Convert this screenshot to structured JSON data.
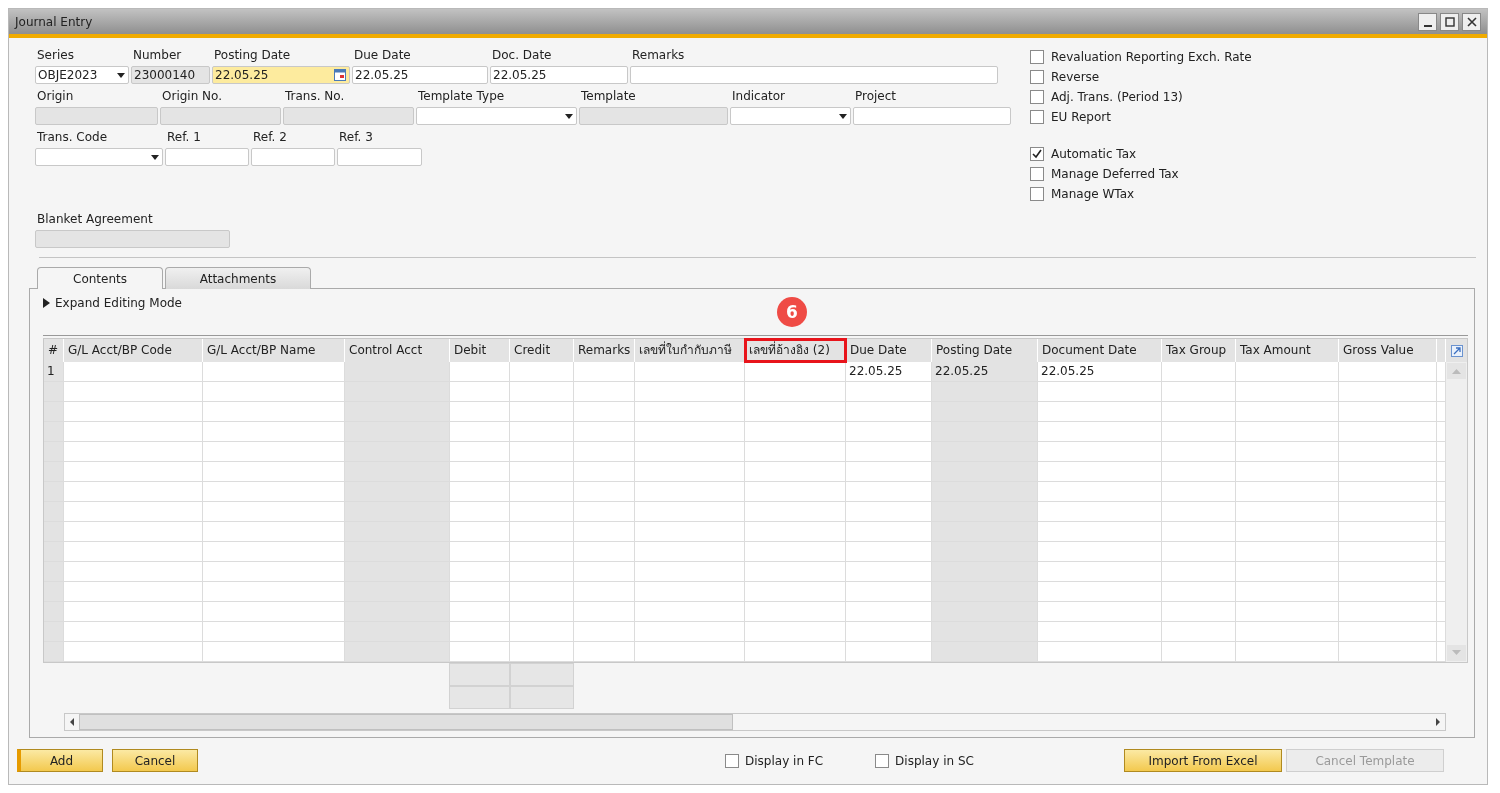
{
  "window": {
    "title": "Journal Entry"
  },
  "field_rows": [
    {
      "fields": [
        {
          "label": "Series",
          "value": "OBJE2023",
          "kind": "dropdown",
          "disabled": false,
          "focused": false
        },
        {
          "label": "Number",
          "value": "23000140",
          "kind": "text",
          "disabled": true,
          "focused": false
        },
        {
          "label": "Posting Date",
          "value": "22.05.25",
          "kind": "date",
          "disabled": false,
          "focused": true
        },
        {
          "label": "Due Date",
          "value": "22.05.25",
          "kind": "text",
          "disabled": false,
          "focused": false
        },
        {
          "label": "Doc. Date",
          "value": "22.05.25",
          "kind": "text",
          "disabled": false,
          "focused": false
        },
        {
          "label": "Remarks",
          "kind": "text",
          "disabled": false,
          "focused": false
        }
      ]
    },
    {
      "fields": [
        {
          "label": "Origin",
          "kind": "text",
          "disabled": true,
          "focused": false
        },
        {
          "label": "Origin No.",
          "kind": "text",
          "disabled": true,
          "focused": false
        },
        {
          "label": "Trans. No.",
          "kind": "text",
          "disabled": true,
          "focused": false
        },
        {
          "label": "Template Type",
          "kind": "dropdown",
          "disabled": false,
          "focused": false
        },
        {
          "label": "Template",
          "kind": "text",
          "disabled": true,
          "focused": false
        },
        {
          "label": "Indicator",
          "kind": "dropdown",
          "disabled": false,
          "focused": false
        },
        {
          "label": "Project",
          "kind": "text",
          "disabled": false,
          "focused": false
        }
      ]
    },
    {
      "fields": [
        {
          "label": "Trans. Code",
          "kind": "dropdown",
          "disabled": false,
          "focused": false
        },
        {
          "label": "Ref. 1",
          "kind": "text",
          "disabled": false,
          "focused": false
        },
        {
          "label": "Ref. 2",
          "kind": "text",
          "disabled": false,
          "focused": false
        },
        {
          "label": "Ref. 3",
          "kind": "text",
          "disabled": false,
          "focused": false
        }
      ]
    }
  ],
  "blanket_agreement": {
    "label": "Blanket Agreement",
    "disabled": true
  },
  "checkbox_groups": [
    {
      "items": [
        {
          "label": "Revaluation Reporting Exch. Rate",
          "checked": false
        },
        {
          "label": "Reverse",
          "checked": false
        },
        {
          "label": "Adj. Trans. (Period 13)",
          "checked": false
        },
        {
          "label": "EU Report",
          "checked": false
        }
      ]
    },
    {
      "items": [
        {
          "label": "Automatic Tax",
          "checked": true
        },
        {
          "label": "Manage Deferred Tax",
          "checked": false
        },
        {
          "label": "Manage WTax",
          "checked": false
        }
      ]
    }
  ],
  "tabs": [
    {
      "label": "Contents",
      "selected": true
    },
    {
      "label": "Attachments",
      "selected": false
    }
  ],
  "expand_toggle": {
    "label": "Expand Editing Mode",
    "expanded": false
  },
  "table": {
    "columns": [
      {
        "label": "#",
        "disabled": true
      },
      {
        "label": "G/L Acct/BP Code",
        "disabled": false
      },
      {
        "label": "G/L Acct/BP Name",
        "disabled": false
      },
      {
        "label": "Control Acct",
        "disabled": true
      },
      {
        "label": "Debit",
        "disabled": false
      },
      {
        "label": "Credit",
        "disabled": false
      },
      {
        "label": "Remarks",
        "disabled": false
      },
      {
        "label": "เลขที่ใบกำกับภาษี",
        "disabled": false
      },
      {
        "label": "เลขที่อ้างอิง (2)",
        "disabled": false,
        "annotation": {
          "badge": "6"
        }
      },
      {
        "label": "Due Date",
        "disabled": false
      },
      {
        "label": "Posting Date",
        "disabled": true
      },
      {
        "label": "Document Date",
        "disabled": false
      },
      {
        "label": "Tax Group",
        "disabled": false
      },
      {
        "label": "Tax Amount",
        "disabled": false
      },
      {
        "label": "Gross Value",
        "disabled": false
      }
    ],
    "rows": [
      {
        "cells": [
          "1",
          null,
          null,
          null,
          null,
          null,
          null,
          null,
          null,
          "22.05.25",
          "22.05.25",
          "22.05.25",
          null,
          null,
          null
        ]
      }
    ]
  },
  "footer": {
    "buttons": [
      {
        "label": "Add",
        "kind": "primary",
        "disabled": false
      },
      {
        "label": "Cancel",
        "kind": "normal",
        "disabled": false
      }
    ],
    "toggles": [
      {
        "label": "Display in FC",
        "checked": false
      },
      {
        "label": "Display in SC",
        "checked": false
      }
    ],
    "right_buttons": [
      {
        "label": "Import From Excel",
        "disabled": false
      },
      {
        "label": "Cancel Template",
        "disabled": true
      }
    ]
  }
}
